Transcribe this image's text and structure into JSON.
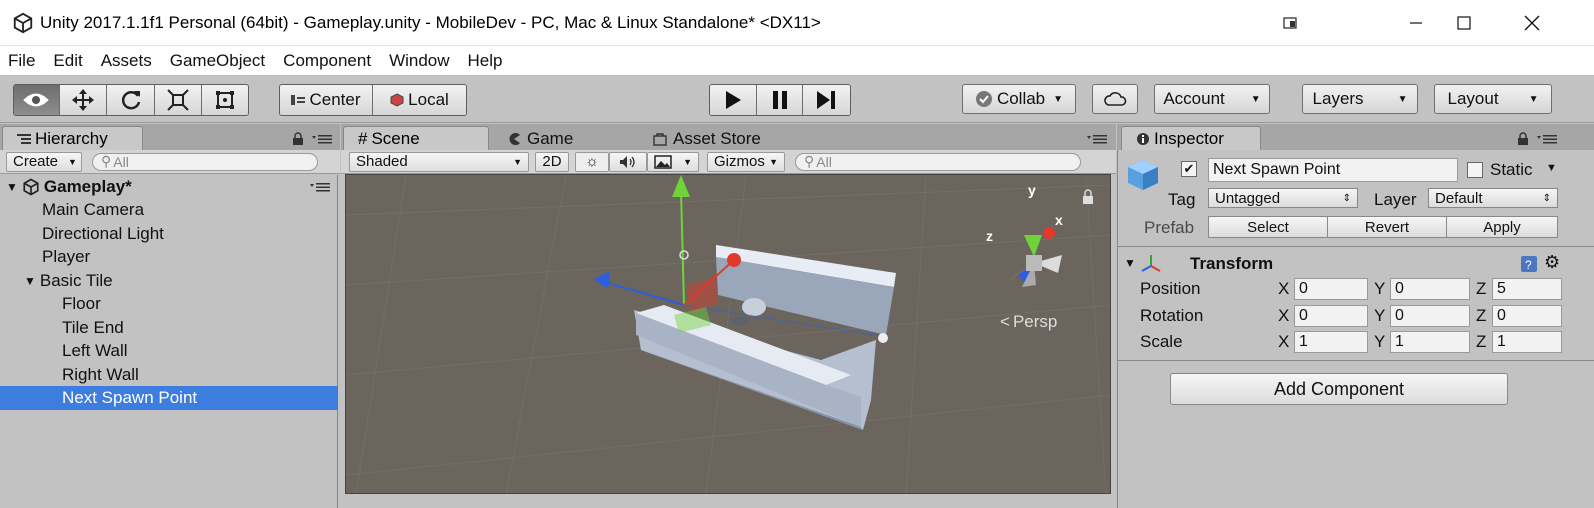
{
  "window": {
    "title": "Unity 2017.1.1f1 Personal (64bit) - Gameplay.unity - MobileDev - PC, Mac & Linux Standalone* <DX11>"
  },
  "menu": [
    "File",
    "Edit",
    "Assets",
    "GameObject",
    "Component",
    "Window",
    "Help"
  ],
  "toolbar": {
    "pivot_label": "Center",
    "space_label": "Local",
    "collab_label": "Collab",
    "account_label": "Account",
    "layers_label": "Layers",
    "layout_label": "Layout"
  },
  "hierarchy": {
    "tab": "Hierarchy",
    "create_label": "Create",
    "search_placeholder": "All",
    "scene_name": "Gameplay*",
    "items": [
      {
        "label": "Main Camera"
      },
      {
        "label": "Directional Light"
      },
      {
        "label": "Player"
      },
      {
        "label": "Basic Tile"
      },
      {
        "label": "Floor"
      },
      {
        "label": "Tile End"
      },
      {
        "label": "Left Wall"
      },
      {
        "label": "Right Wall"
      },
      {
        "label": "Next Spawn Point"
      }
    ]
  },
  "scene": {
    "tabs": [
      "Scene",
      "Game",
      "Asset Store"
    ],
    "shading_mode": "Shaded",
    "mode_2d": "2D",
    "gizmos_label": "Gizmos",
    "search_placeholder": "All",
    "projection_label": "Persp",
    "axis_labels": {
      "x": "x",
      "y": "y",
      "z": "z"
    }
  },
  "inspector": {
    "tab": "Inspector",
    "object_name": "Next Spawn Point",
    "static_label": "Static",
    "tag_label": "Tag",
    "tag_value": "Untagged",
    "layer_label": "Layer",
    "layer_value": "Default",
    "prefab_label": "Prefab",
    "prefab_select": "Select",
    "prefab_revert": "Revert",
    "prefab_apply": "Apply",
    "transform": {
      "title": "Transform",
      "position_label": "Position",
      "rotation_label": "Rotation",
      "scale_label": "Scale",
      "axis_x": "X",
      "axis_y": "Y",
      "axis_z": "Z",
      "position": {
        "x": "0",
        "y": "0",
        "z": "5"
      },
      "rotation": {
        "x": "0",
        "y": "0",
        "z": "0"
      },
      "scale": {
        "x": "1",
        "y": "1",
        "z": "1"
      }
    },
    "add_component_label": "Add Component"
  },
  "colors": {
    "selection": "#3e7de0",
    "gizmo_x": "#e03a2a",
    "gizmo_y": "#6fd23a",
    "gizmo_z": "#2f5fe0"
  }
}
